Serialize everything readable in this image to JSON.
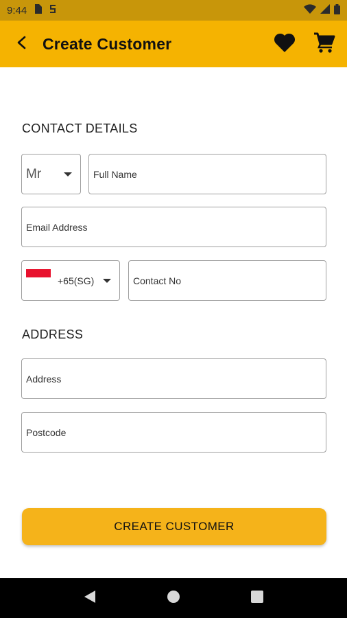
{
  "status_bar": {
    "time": "9:44"
  },
  "app_bar": {
    "title": "Create Customer",
    "icons": [
      "back-arrow-icon",
      "heart-icon",
      "cart-icon"
    ]
  },
  "colors": {
    "accent": "#f5b301",
    "status_bar": "#c8960a",
    "button": "#f5b31a",
    "flag_red": "#e8112d"
  },
  "contact": {
    "section_title": "CONTACT DETAILS",
    "salutation": "Mr",
    "full_name_placeholder": "Full Name",
    "email_placeholder": "Email Address",
    "country_code": "+65(SG)",
    "contact_placeholder": "Contact No"
  },
  "address": {
    "section_title": "ADDRESS",
    "address_placeholder": "Address",
    "postcode_placeholder": "Postcode"
  },
  "actions": {
    "create_label": "CREATE CUSTOMER"
  }
}
